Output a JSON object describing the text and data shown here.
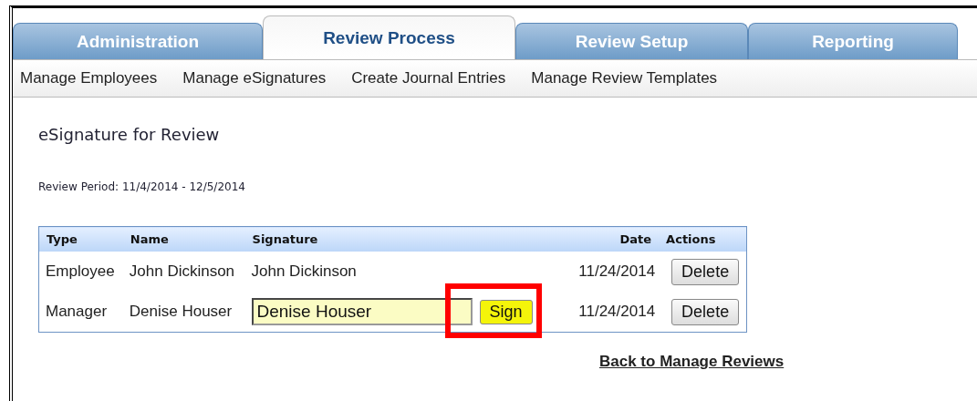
{
  "tabs": [
    {
      "label": "Administration",
      "selected": false
    },
    {
      "label": "Review Process",
      "selected": true
    },
    {
      "label": "Review Setup",
      "selected": false
    },
    {
      "label": "Reporting",
      "selected": false
    }
  ],
  "subnav": [
    "Manage Employees",
    "Manage eSignatures",
    "Create Journal Entries",
    "Manage Review Templates"
  ],
  "heading": "eSignature for Review",
  "review_period": "Review Period: 11/4/2014 - 12/5/2014",
  "table": {
    "columns": [
      "Type",
      "Name",
      "Signature",
      "Date",
      "Actions"
    ],
    "rows": [
      {
        "kind": "signed",
        "type": "Employee",
        "name": "John Dickinson",
        "signature": "John Dickinson",
        "date": "11/24/2014",
        "action": "Delete"
      },
      {
        "kind": "unsigned",
        "type": "Manager",
        "name": "Denise Houser",
        "signature": "Denise Houser",
        "sign_button": "Sign",
        "highlighted": true,
        "date": "11/24/2014",
        "action": "Delete"
      }
    ]
  },
  "back_link": "Back to Manage Reviews"
}
